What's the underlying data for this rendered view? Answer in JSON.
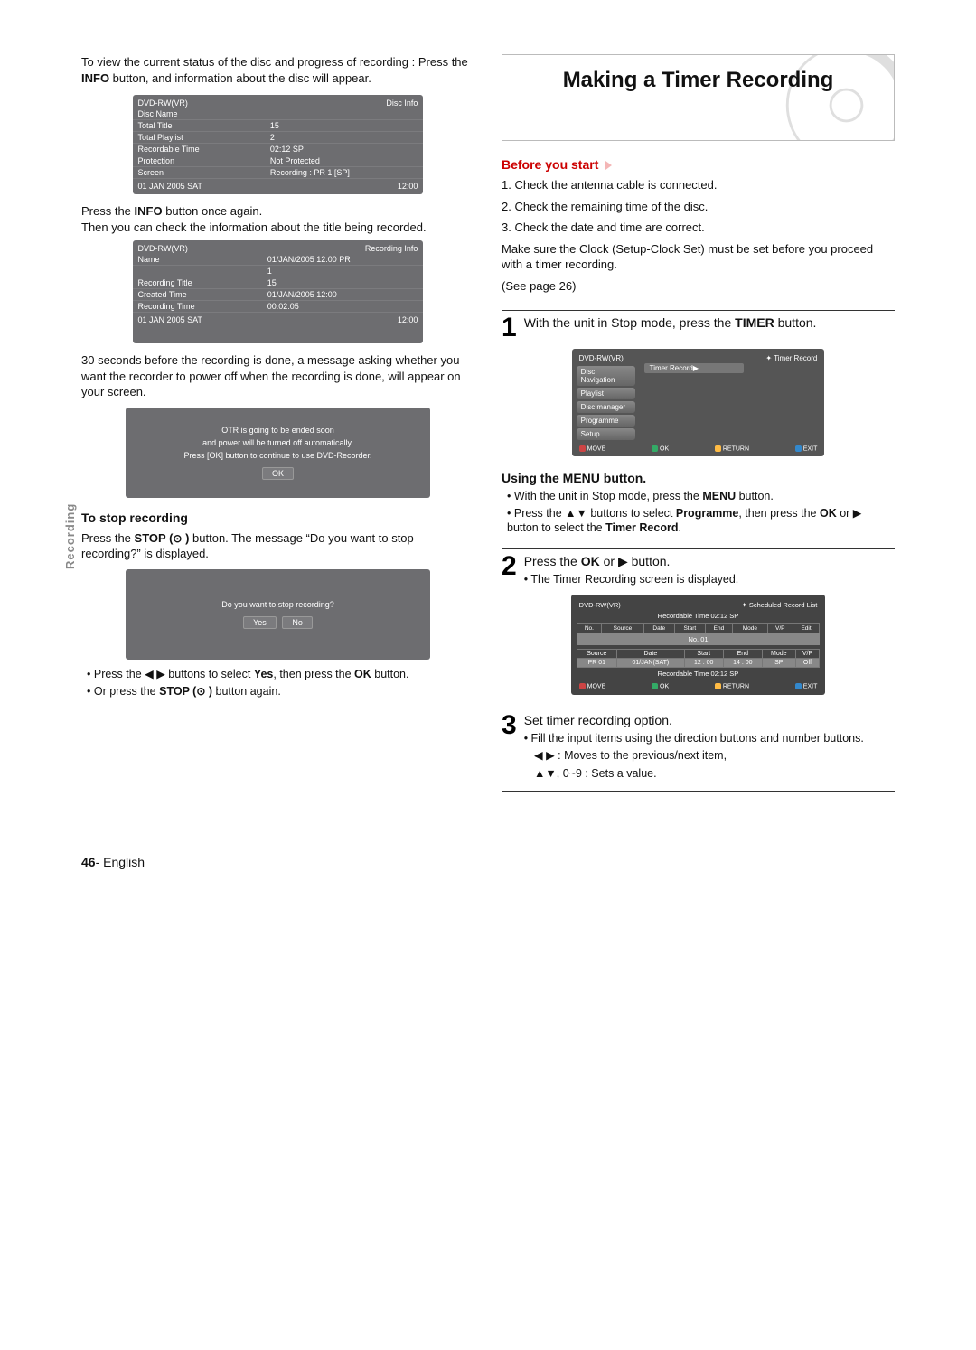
{
  "left": {
    "intro": "To view the current status of the disc and progress of recording : Press the ",
    "intro_bold": "INFO",
    "intro2": " button, and information about the disc will appear.",
    "osd1": {
      "hdr_l": "DVD-RW(VR)",
      "hdr_r": "Disc Info",
      "rows": [
        [
          "Disc Name",
          ""
        ],
        [
          "Total Title",
          "15"
        ],
        [
          "Total Playlist",
          "2"
        ],
        [
          "Recordable Time",
          "02:12  SP"
        ],
        [
          "Protection",
          "Not Protected"
        ],
        [
          "Screen",
          "Recording : PR 1 [SP]"
        ]
      ],
      "ft_l": "01 JAN 2005 SAT",
      "ft_r": "12:00"
    },
    "press_info_again": "Press the ",
    "press_info_again_b": "INFO",
    "press_info_again2": " button once again.",
    "then_check": "Then you can check the information about the title being recorded.",
    "osd2": {
      "hdr_l": "DVD-RW(VR)",
      "hdr_r": "Recording Info",
      "rows": [
        [
          "Name",
          "01/JAN/2005 12:00 PR"
        ],
        [
          "",
          "1"
        ],
        [
          "Recording Title",
          "15"
        ],
        [
          "Created Time",
          "01/JAN/2005 12:00"
        ],
        [
          "Recording Time",
          "00:02:05"
        ]
      ],
      "ft_l": "01 JAN 2005 SAT",
      "ft_r": "12:00"
    },
    "thirtysec": "30 seconds before the recording is done, a message asking whether you want the recorder to power off when the recording is done, will appear on your screen.",
    "msg1_l1": "OTR is going to be ended soon",
    "msg1_l2": "and power will be turned off automatically.",
    "msg1_l3": "Press [OK] button to continue to use DVD-Recorder.",
    "msg1_btn": "OK",
    "stop_head": "To stop recording",
    "stop_p1a": "Press the ",
    "stop_p1b": "STOP (",
    "stop_p1c": " )",
    "stop_p1d": " button. The message “Do you want to stop recording?” is displayed.",
    "msg2_q": "Do you want to stop recording?",
    "msg2_yes": "Yes",
    "msg2_no": "No",
    "b1": "Press the ◀ ▶ buttons to select ",
    "b1b": "Yes",
    "b1c": ", then press the ",
    "b1d": "OK",
    "b1e": " button.",
    "b2a": "Or press the ",
    "b2b": "STOP (",
    "b2c": " )",
    "b2d": " button again."
  },
  "right": {
    "title": "Making a Timer Recording",
    "before": "Before you start",
    "chk1": "1. Check the antenna cable is connected.",
    "chk2": "2. Check the remaining time of the disc.",
    "chk3": "3. Check the date and time are correct.",
    "chk4": "Make sure the Clock (Setup-Clock Set) must be set before you proceed with a timer recording.",
    "chk5": "(See page 26)",
    "s1": "With the unit in Stop mode, press the ",
    "s1b": "TIMER",
    "s1c": " button.",
    "osd_menu": {
      "hdr_l": "DVD-RW(VR)",
      "hdr_r": "Timer Record",
      "items": [
        "Disc Navigation",
        "Playlist",
        "Disc manager",
        "Programme",
        "Setup"
      ],
      "sel": "Timer Record",
      "move": "MOVE",
      "ok": "OK",
      "ret": "RETURN",
      "exit": "EXIT"
    },
    "menu_head": "Using the MENU button.",
    "mb1": "With the unit in Stop mode, press the ",
    "mb1b": "MENU",
    "mb1c": " button.",
    "mb2": "Press the ▲▼ buttons to select ",
    "mb2b": "Programme",
    "mb2c": ", then press the ",
    "mb2d": "OK",
    "mb2e": " or  ▶ button to select the ",
    "mb2f": "Timer Record",
    "mb2g": ".",
    "s2a": "Press the ",
    "s2b": "OK",
    "s2c": " or ▶ button.",
    "s2d": "The Timer Recording screen is displayed.",
    "osd_sched": {
      "hdr_l": "DVD-RW(VR)",
      "hdr_r": "Scheduled Record List",
      "rectime": "Recordable Time 02:12 SP",
      "header": [
        "No.",
        "Source",
        "Date",
        "Start",
        "End",
        "Mode",
        "V/P",
        "Edit"
      ],
      "hi": "No. 01",
      "cols": [
        "Source",
        "Date",
        "Start",
        "End",
        "Mode",
        "V/P"
      ],
      "row": [
        "PR 01",
        "01/JAN(SAT)",
        "12 : 00",
        "14 : 00",
        "SP",
        "Off"
      ],
      "rectime2": "Recordable Time 02:12 SP",
      "move": "MOVE",
      "ok": "OK",
      "ret": "RETURN",
      "exit": "EXIT"
    },
    "s3a": "Set timer recording option.",
    "s3b": "Fill the input items using the direction buttons and number buttons.",
    "s3c": "◀ ▶ : Moves to the previous/next item,",
    "s3d": "▲▼, 0~9 : Sets a value."
  },
  "sidetab": "Recording",
  "page_no": "46",
  "page_lang": "- English"
}
